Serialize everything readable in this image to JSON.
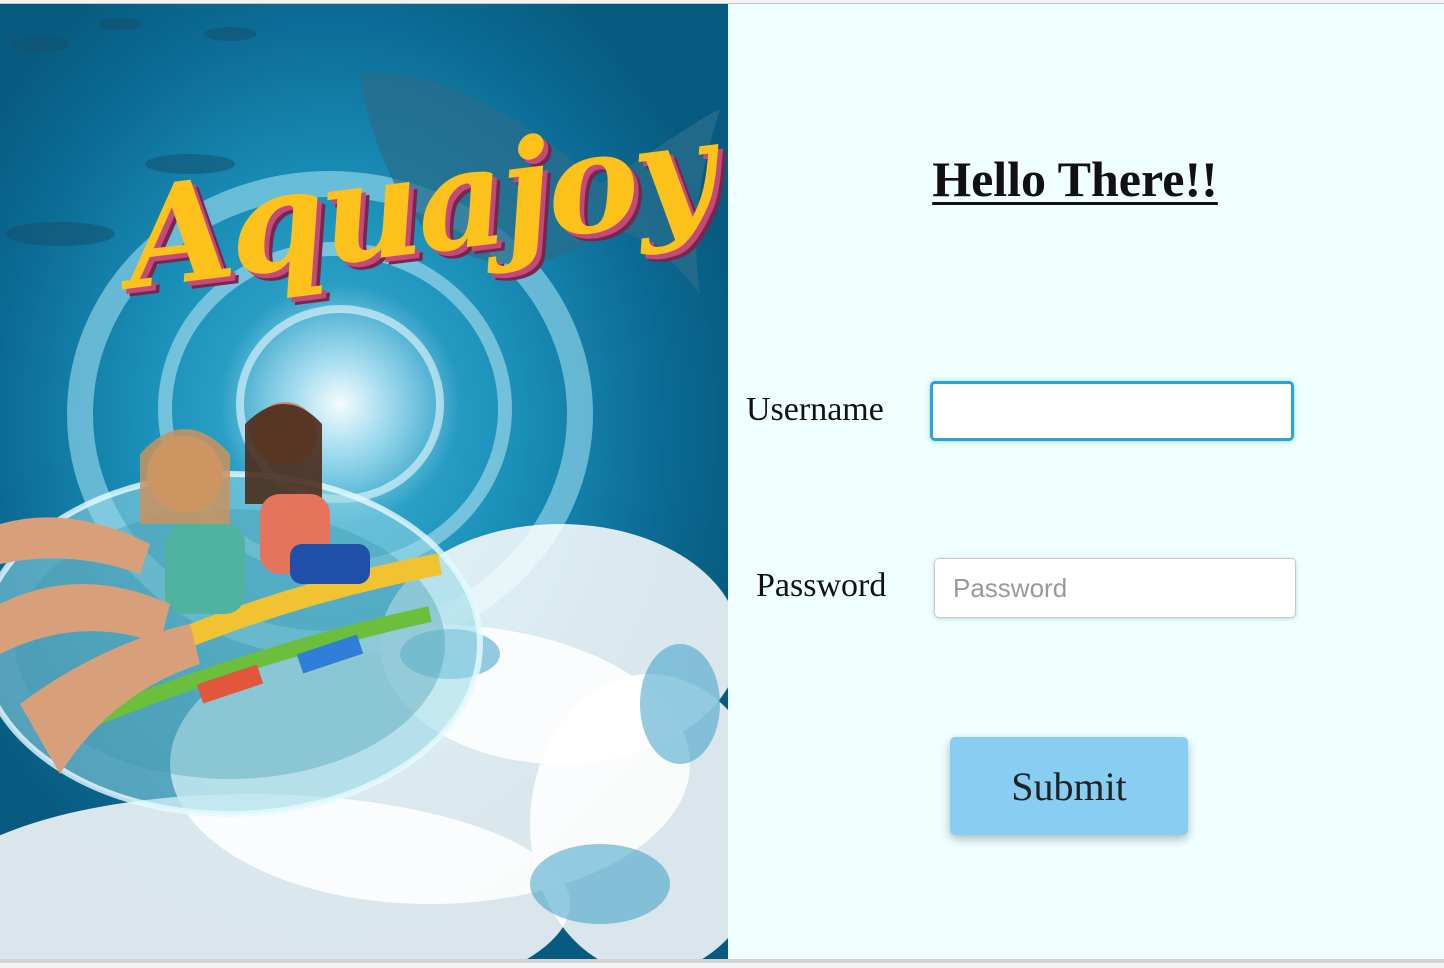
{
  "poster": {
    "brand_logo_text": "Aquajoy",
    "palette": {
      "water_deep": "#085b80",
      "water_light": "#3fb3d6",
      "logo_yellow": "#fcc21b",
      "logo_shadow": "#c24b7a"
    }
  },
  "login": {
    "heading": "Hello There!!",
    "username": {
      "label": "Username",
      "value": "",
      "placeholder": ""
    },
    "password": {
      "label": "Password",
      "value": "",
      "placeholder": "Password"
    },
    "submit_label": "Submit"
  },
  "colors": {
    "panel_background": "#f0ffff",
    "submit_button": "#87cef2",
    "focus_border": "#2aa3d6"
  }
}
